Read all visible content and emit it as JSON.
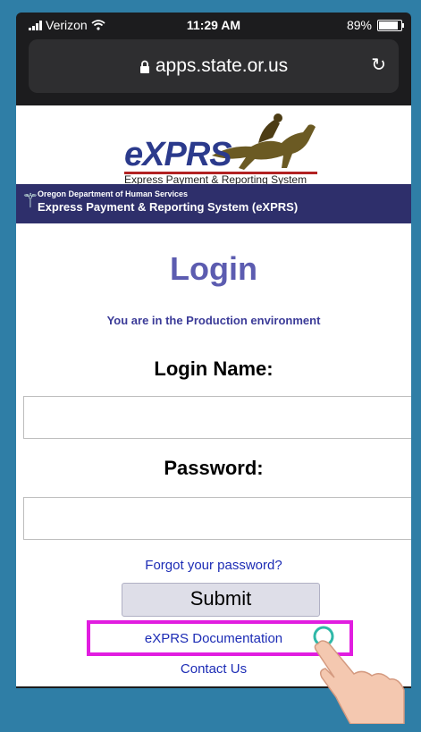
{
  "status": {
    "carrier": "Verizon",
    "time": "11:29 AM",
    "battery": "89%",
    "battery_level": 0.89
  },
  "browser": {
    "url": "apps.state.or.us",
    "icons": [
      "lock-icon",
      "reload-icon",
      "wifi-icon",
      "signal-icon",
      "battery-icon"
    ]
  },
  "header": {
    "logo_text": "eXPRS",
    "logo_subtitle": "Express Payment & Reporting System",
    "banner_org": "Oregon Department of Human Services",
    "banner_title": "Express Payment & Reporting System (eXPRS)"
  },
  "main": {
    "title": "Login",
    "environment_note": "You are in the Production environment",
    "login_label": "Login Name:",
    "password_label": "Password:",
    "forgot_link": "Forgot your password?",
    "submit_label": "Submit",
    "documentation_link": "eXPRS Documentation",
    "contact_link": "Contact Us"
  },
  "colors": {
    "accent": "#5c5cb0",
    "link": "#1c2cb5",
    "highlight": "#e11de0",
    "banner": "#2e2f6b",
    "background": "#2f7ea6"
  }
}
